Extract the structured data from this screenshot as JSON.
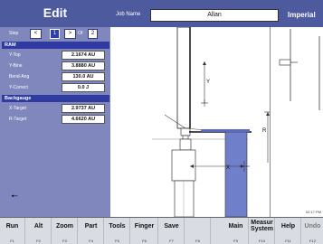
{
  "header": {
    "title": "Edit",
    "job_name_label": "Job Name",
    "job_name_value": "Allan",
    "units": "Imperial"
  },
  "step": {
    "label": "Step",
    "prev": "<",
    "current": "1",
    "next": ">",
    "of_label": "Of",
    "total": "2"
  },
  "ram": {
    "section_title": "RAM",
    "params": [
      {
        "label": "Y-Top",
        "value": "2.1674 AU"
      },
      {
        "label": "Y-Bine",
        "value": "3.8880 AU"
      },
      {
        "label": "Bend-Ang",
        "value": "130.0 AU"
      },
      {
        "label": "Y-Correct",
        "value": "0.0 J"
      }
    ]
  },
  "backgauge": {
    "section_title": "Backgauge",
    "params": [
      {
        "label": "X-Target",
        "value": "2.9737 AU"
      },
      {
        "label": "R-Target",
        "value": "4.6620 AU"
      }
    ]
  },
  "graphic": {
    "y_axis_label": "Y",
    "r_axis_label": "R",
    "x_axis_label": "X"
  },
  "status": {
    "time": "02:17 PM"
  },
  "colors": {
    "panel_bg": "#7f87bd",
    "header_bg": "#4e5a9e",
    "section_bg": "#2f3ba0",
    "workpiece": "#6f7fc9"
  },
  "fkeys": [
    {
      "label": "Run",
      "code": "F1"
    },
    {
      "label": "Alt",
      "code": "F2"
    },
    {
      "label": "Zoom",
      "code": "F3"
    },
    {
      "label": "Part",
      "code": "F4"
    },
    {
      "label": "Tools",
      "code": "F5"
    },
    {
      "label": "Finger",
      "code": "F6"
    },
    {
      "label": "Save",
      "code": "F7"
    },
    {
      "label": "",
      "code": "F8"
    },
    {
      "label": "Main",
      "code": "F9"
    },
    {
      "label": "Measur System",
      "code": "F10"
    },
    {
      "label": "Help",
      "code": "F11"
    },
    {
      "label": "Undo",
      "code": "F12"
    }
  ]
}
